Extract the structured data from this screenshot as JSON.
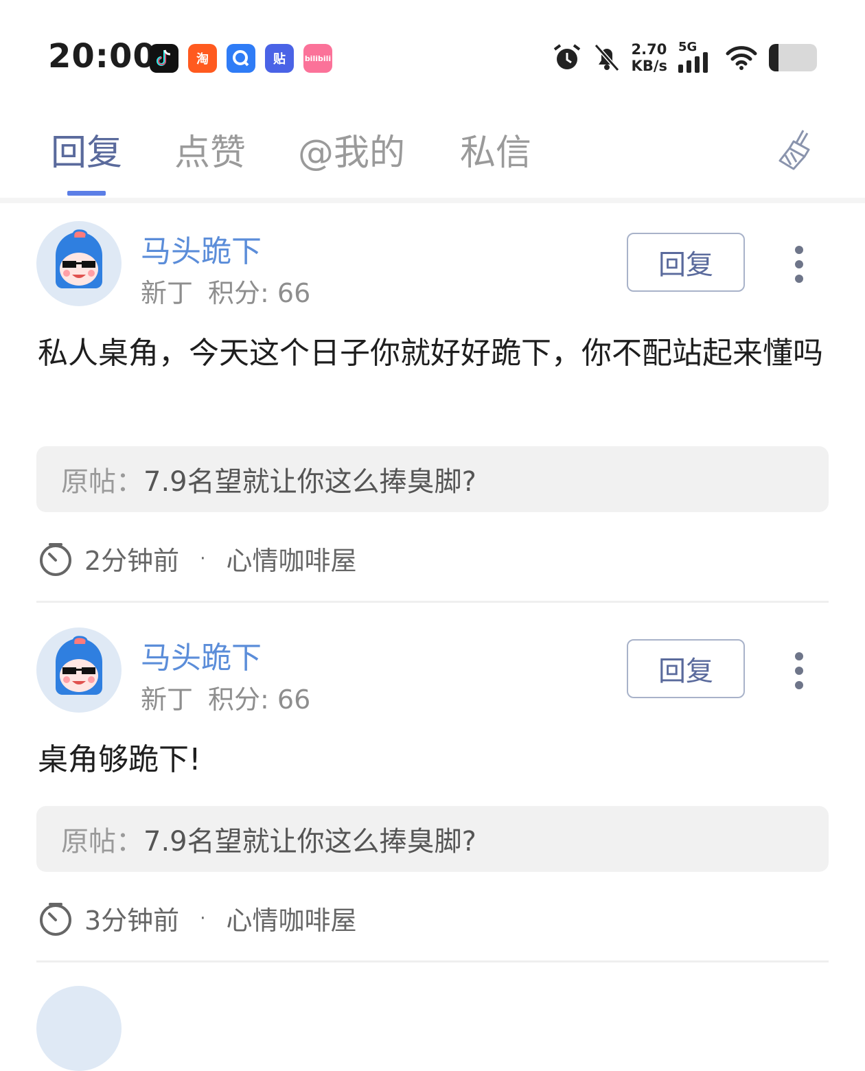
{
  "status_bar": {
    "time": "20:00",
    "apps": [
      {
        "icon": "tiktok-icon",
        "label": "",
        "color": "#111111"
      },
      {
        "icon": "taobao-icon",
        "label": "淘",
        "color": "#ff5a1f"
      },
      {
        "icon": "quark-icon",
        "label": "",
        "color": "#2f7cf6"
      },
      {
        "icon": "tieba-icon",
        "label": "贴",
        "color": "#4a63e6"
      },
      {
        "icon": "bilibili-icon",
        "label": "bilibili",
        "color": "#fb7299"
      }
    ],
    "net_speed_value": "2.70",
    "net_speed_unit": "KB/s",
    "network": "5G",
    "battery_level": 0.2
  },
  "tabs": [
    {
      "label": "回复",
      "active": true
    },
    {
      "label": "点赞",
      "active": false
    },
    {
      "label": "@我的",
      "active": false
    },
    {
      "label": "私信",
      "active": false
    }
  ],
  "clear_icon": "broom-icon",
  "messages": [
    {
      "user": "马头跪下",
      "level": "新丁",
      "points": "积分: 66",
      "reply_label": "回复",
      "content": "私人桌角，今天这个日子你就好好跪下，你不配站起来懂吗",
      "original_prefix": "原帖：",
      "original_title": "7.9名望就让你这么捧臭脚?",
      "time": "2分钟前",
      "forum": "心情咖啡屋"
    },
    {
      "user": "马头跪下",
      "level": "新丁",
      "points": "积分: 66",
      "reply_label": "回复",
      "content": "桌角够跪下!",
      "original_prefix": "原帖：",
      "original_title": "7.9名望就让你这么捧臭脚?",
      "time": "3分钟前",
      "forum": "心情咖啡屋"
    }
  ],
  "meta_separator": "·"
}
